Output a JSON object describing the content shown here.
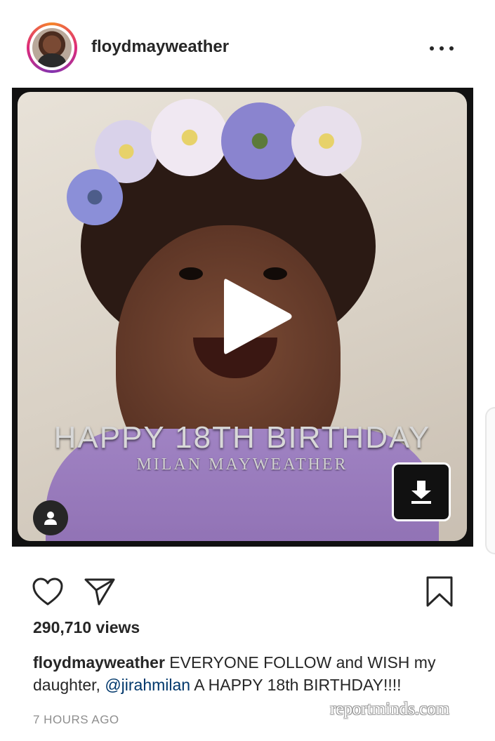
{
  "post": {
    "username": "floydmayweather",
    "more_icon": "more-horizontal-icon",
    "media": {
      "overlay_title": "HAPPY 18TH BIRTHDAY",
      "overlay_subtitle": "MILAN MAYWEATHER",
      "play_icon": "play-icon",
      "tag_icon": "user-tag-icon",
      "download_icon": "download-icon"
    },
    "actions": {
      "like_icon": "heart-icon",
      "share_icon": "paper-plane-icon",
      "save_icon": "bookmark-icon"
    },
    "views": "290,710 views",
    "caption": {
      "username": "floydmayweather",
      "text_before_mention": " EVERYONE FOLLOW and WISH my daughter, ",
      "mention": "@jirahmilan",
      "text_after_mention": " A HAPPY 18th BIRTHDAY!!!!"
    },
    "timestamp": "7 HOURS AGO"
  },
  "watermark": "reportminds.com",
  "colors": {
    "text": "#262626",
    "mention": "#00376b",
    "muted": "#8e8e8e"
  }
}
